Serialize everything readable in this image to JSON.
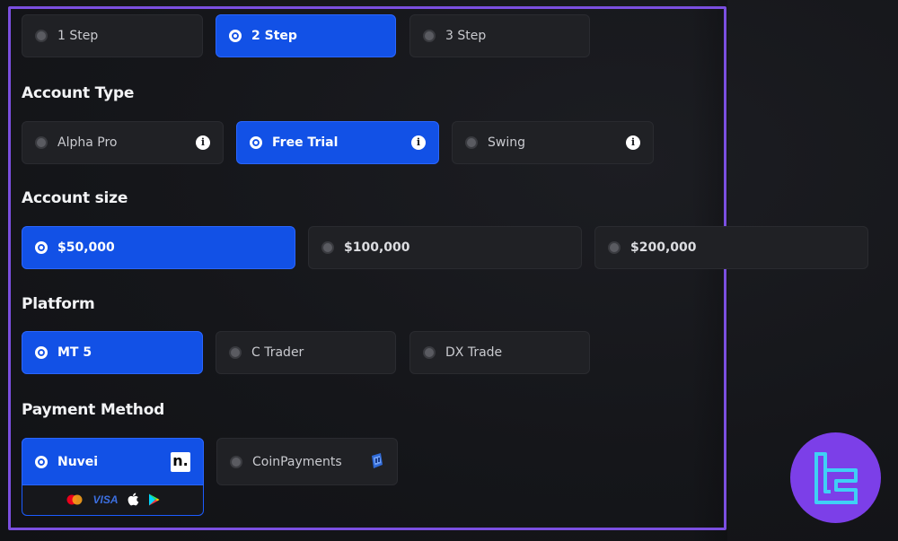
{
  "steps": {
    "options": [
      {
        "label": "1 Step",
        "selected": false
      },
      {
        "label": "2 Step",
        "selected": true
      },
      {
        "label": "3 Step",
        "selected": false
      }
    ]
  },
  "account_type": {
    "title": "Account Type",
    "options": [
      {
        "label": "Alpha Pro",
        "selected": false,
        "info_icon": "i"
      },
      {
        "label": "Free Trial",
        "selected": true,
        "info_icon": "i"
      },
      {
        "label": "Swing",
        "selected": false,
        "info_icon": "i"
      }
    ]
  },
  "account_size": {
    "title": "Account size",
    "options": [
      {
        "label": "$50,000",
        "selected": true
      },
      {
        "label": "$100,000",
        "selected": false
      },
      {
        "label": "$200,000",
        "selected": false
      }
    ]
  },
  "platform": {
    "title": "Platform",
    "options": [
      {
        "label": "MT 5",
        "selected": true
      },
      {
        "label": "C Trader",
        "selected": false
      },
      {
        "label": "DX Trade",
        "selected": false
      }
    ]
  },
  "payment_method": {
    "title": "Payment Method",
    "options": [
      {
        "label": "Nuvei",
        "selected": true,
        "logo_text": "n.",
        "logo": "nuvei-logo"
      },
      {
        "label": "CoinPayments",
        "selected": false,
        "logo": "coinpayments-logo"
      }
    ],
    "accepted": {
      "visa_text": "VISA",
      "icons": [
        "mastercard-icon",
        "visa-icon",
        "apple-icon",
        "google-play-icon"
      ]
    }
  },
  "colors": {
    "accent": "#1251e6",
    "frame": "#7b4fe0",
    "brand_circle": "#7c3fe8",
    "brand_glyph": "#3fd0f5"
  }
}
